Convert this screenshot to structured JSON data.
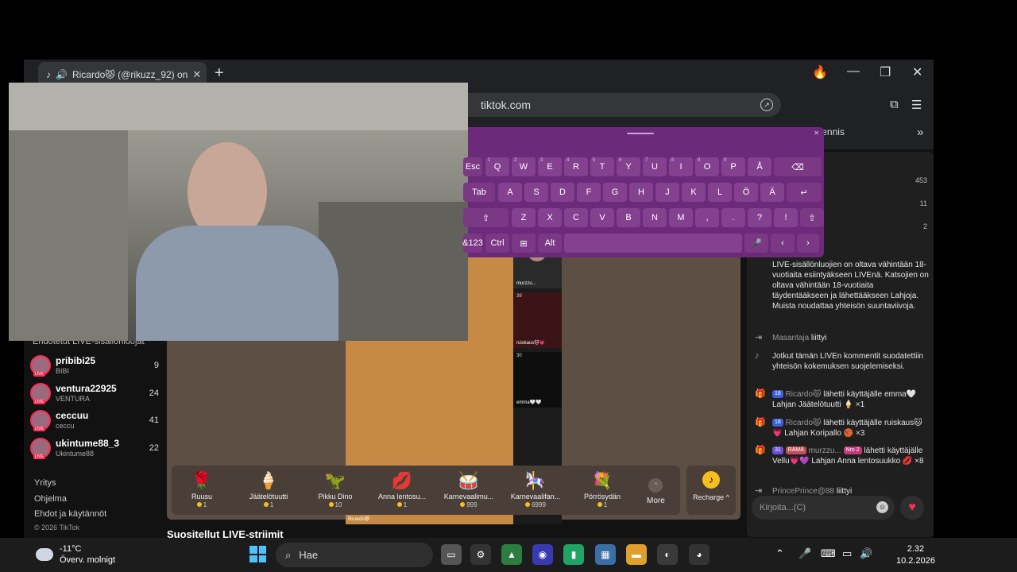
{
  "browser": {
    "tab_title": "Ricardo😾 (@rikuzz_92) on",
    "url": "tiktok.com",
    "bookmark": "Tennis"
  },
  "sidebar": {
    "suggested_title": "Ehdotetut LIVE-sisällönluojat",
    "creators": [
      {
        "name": "pribibi25",
        "sub": "BIBI",
        "count": "9"
      },
      {
        "name": "ventura22925",
        "sub": "VENTURA",
        "count": "24"
      },
      {
        "name": "ceccuu",
        "sub": "ceccu",
        "count": "41"
      },
      {
        "name": "ukintume88_3",
        "sub": "Ukintume88",
        "count": "22"
      }
    ],
    "footer": {
      "company": "Yritys",
      "program": "Ohjelma",
      "terms": "Ehdot ja käytännöt",
      "copyright": "© 2026 TikTok"
    },
    "live_badge": "LIVE"
  },
  "stage": {
    "host_tag": "Ricardo😾",
    "guests": [
      {
        "name": "murzzu...",
        "count": ""
      },
      {
        "name": "ruiskaus🐱💗",
        "count": "39"
      },
      {
        "name": "emma🤍🤍",
        "count": "30"
      }
    ],
    "lower_title": "Suositellut LIVE-striimit"
  },
  "gifts": [
    {
      "name": "Ruusu",
      "price": "1",
      "icon": "🌹"
    },
    {
      "name": "Jäätelötuutti",
      "price": "1",
      "icon": "🍦"
    },
    {
      "name": "Pikku Dino",
      "price": "10",
      "icon": "🦖"
    },
    {
      "name": "Anna lentosu...",
      "price": "1",
      "icon": "💋"
    },
    {
      "name": "Karnevaalimu...",
      "price": "999",
      "icon": "🥁"
    },
    {
      "name": "Karnevaalifan...",
      "price": "6999",
      "icon": "🎠"
    },
    {
      "name": "Pörrösydän",
      "price": "1",
      "icon": "💐"
    }
  ],
  "more_label": "More",
  "recharge_label": "Recharge ^",
  "chat": {
    "ranking": [
      "453",
      "11",
      "2"
    ],
    "messages": {
      "notice": "LIVE-sisällönluojien on oltava vähintään 18-vuotiaita esiintyäkseen LIVEnä. Katsojien on oltava vähintään 18-vuotiaita täydentääkseen ja lähettääkseen Lahjoja. Muista noudattaa yhteisön suuntaviivoja.",
      "join1_user": "Masantaja",
      "join1_text": "liittyi",
      "filter": "Jotkut tämän LIVEn kommentit suodatettiin yhteisön kokemuksen suojelemiseksi.",
      "g1_badge": "18",
      "g1_user": "Ricardo😾",
      "g1_text": "lähetti käyttäjälle emma🤍",
      "g1_gift": "Lahjan Jäätelötuutti 🍦 ×1",
      "g2_badge": "18",
      "g2_user": "Ricardo😾",
      "g2_text": "lähetti käyttäjälle ruiskaus🐱💗",
      "g2_gift": "Lahjan Koripallo 🏀 ×3",
      "g3_badge": "31",
      "g3_badge2": "RÄMÄ",
      "g3_user": "murzzu...",
      "g3_badge3": "Nro 2",
      "g3_text": "lähetti käyttäjälle Vellu💗💜",
      "g3_gift": "Lahjan Anna lentosuukko 💋 ×8",
      "join2_user": "PrincePrince@88",
      "join2_text": "liittyi"
    },
    "input_placeholder": "Kirjoita...(C)"
  },
  "keyboard": {
    "row1": [
      [
        "Esc",
        ""
      ],
      [
        "Q",
        "1"
      ],
      [
        "W",
        "2"
      ],
      [
        "E",
        "3"
      ],
      [
        "R",
        "4"
      ],
      [
        "T",
        "5"
      ],
      [
        "Y",
        "6"
      ],
      [
        "U",
        "7"
      ],
      [
        "I",
        "8"
      ],
      [
        "O",
        "9"
      ],
      [
        "P",
        "0"
      ],
      [
        "Å",
        ""
      ],
      [
        "⌫",
        ""
      ]
    ],
    "row2": [
      "Tab",
      "A",
      "S",
      "D",
      "F",
      "G",
      "H",
      "J",
      "K",
      "L",
      "Ö",
      "Ä",
      "↵"
    ],
    "row3": [
      "⇧",
      "Z",
      "X",
      "C",
      "V",
      "B",
      "N",
      "M",
      ",",
      ".",
      "?",
      "!",
      "⇧"
    ],
    "row4": [
      "&123",
      "Ctrl",
      "⊞",
      "Alt",
      "",
      "🎤",
      "‹",
      "›"
    ]
  },
  "taskbar": {
    "temp": "-11°C",
    "condition": "Överv. molnigt",
    "search": "Hae",
    "time": "2.32",
    "date": "10.2.2026"
  }
}
